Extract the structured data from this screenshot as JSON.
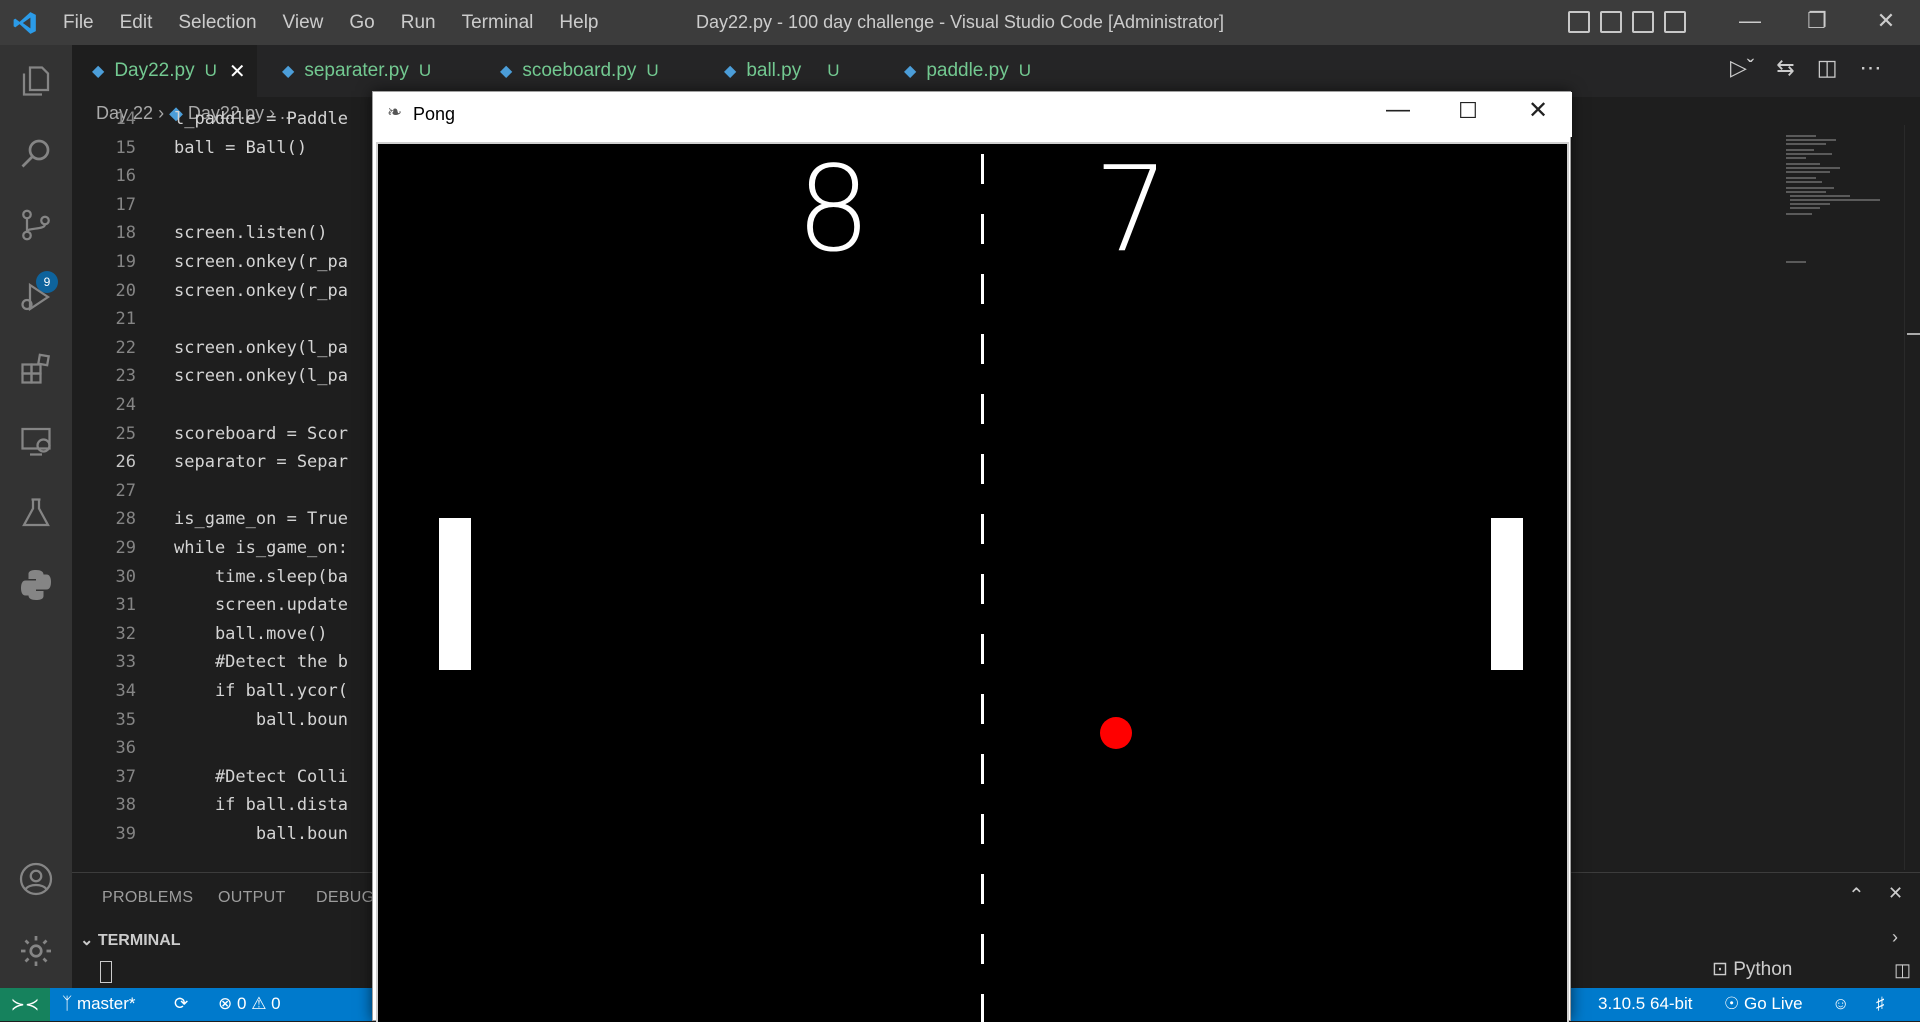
{
  "window": {
    "title": "Day22.py - 100 day challenge - Visual Studio Code [Administrator]",
    "menu": [
      "File",
      "Edit",
      "Selection",
      "View",
      "Go",
      "Run",
      "Terminal",
      "Help"
    ]
  },
  "activity_bar": {
    "items": [
      "explorer-icon",
      "search-icon",
      "source-control-icon",
      "run-debug-icon",
      "extensions-icon",
      "remote-explorer-icon",
      "testing-icon",
      "python-icon"
    ],
    "source_control_badge": "9",
    "bottom": [
      "account-icon",
      "settings-gear-icon"
    ]
  },
  "tabs": [
    {
      "label": "Day22.py",
      "status": "U",
      "active": true
    },
    {
      "label": "separater.py",
      "status": "U"
    },
    {
      "label": "scoeboard.py",
      "status": "U"
    },
    {
      "label": "ball.py",
      "status": "U"
    },
    {
      "label": "paddle.py",
      "status": "U"
    }
  ],
  "breadcrumb": {
    "folder": "Day 22",
    "file": "Day22.py",
    "more": "..."
  },
  "editor": {
    "current_line": "26",
    "lines": [
      {
        "n": "14",
        "text": "l_paddle = Paddle"
      },
      {
        "n": "15",
        "text": "ball = Ball()"
      },
      {
        "n": "16",
        "text": ""
      },
      {
        "n": "17",
        "text": ""
      },
      {
        "n": "18",
        "text": "screen.listen()"
      },
      {
        "n": "19",
        "text": "screen.onkey(r_pa"
      },
      {
        "n": "20",
        "text": "screen.onkey(r_pa"
      },
      {
        "n": "21",
        "text": ""
      },
      {
        "n": "22",
        "text": "screen.onkey(l_pa"
      },
      {
        "n": "23",
        "text": "screen.onkey(l_pa"
      },
      {
        "n": "24",
        "text": ""
      },
      {
        "n": "25",
        "text": "scoreboard = Scor"
      },
      {
        "n": "26",
        "text": "separator = Separ"
      },
      {
        "n": "27",
        "text": ""
      },
      {
        "n": "28",
        "text": "is_game_on = True"
      },
      {
        "n": "29",
        "text": "while is_game_on:"
      },
      {
        "n": "30",
        "text": "    time.sleep(ba"
      },
      {
        "n": "31",
        "text": "    screen.update"
      },
      {
        "n": "32",
        "text": "    ball.move()"
      },
      {
        "n": "33",
        "text": "    #Detect the b"
      },
      {
        "n": "34",
        "text": "    if ball.ycor("
      },
      {
        "n": "35",
        "text": "        ball.boun"
      },
      {
        "n": "36",
        "text": ""
      },
      {
        "n": "37",
        "text": "    #Detect Colli"
      },
      {
        "n": "38",
        "text": "    if ball.dista"
      },
      {
        "n": "39",
        "text": "        ball.boun"
      }
    ]
  },
  "panel": {
    "tabs": [
      "PROBLEMS",
      "OUTPUT",
      "DEBUG"
    ],
    "terminal_header": "TERMINAL",
    "terminal_type": "Python"
  },
  "status_bar": {
    "branch": "master*",
    "errors": "0",
    "warnings": "0",
    "python_version": "3.10.5 64-bit",
    "go_live": "Go Live"
  },
  "pong": {
    "title": "Pong",
    "left_score": "8",
    "right_score": "7",
    "colors": {
      "background": "#000000",
      "paddle": "#ffffff",
      "ball": "#ff0000"
    }
  }
}
